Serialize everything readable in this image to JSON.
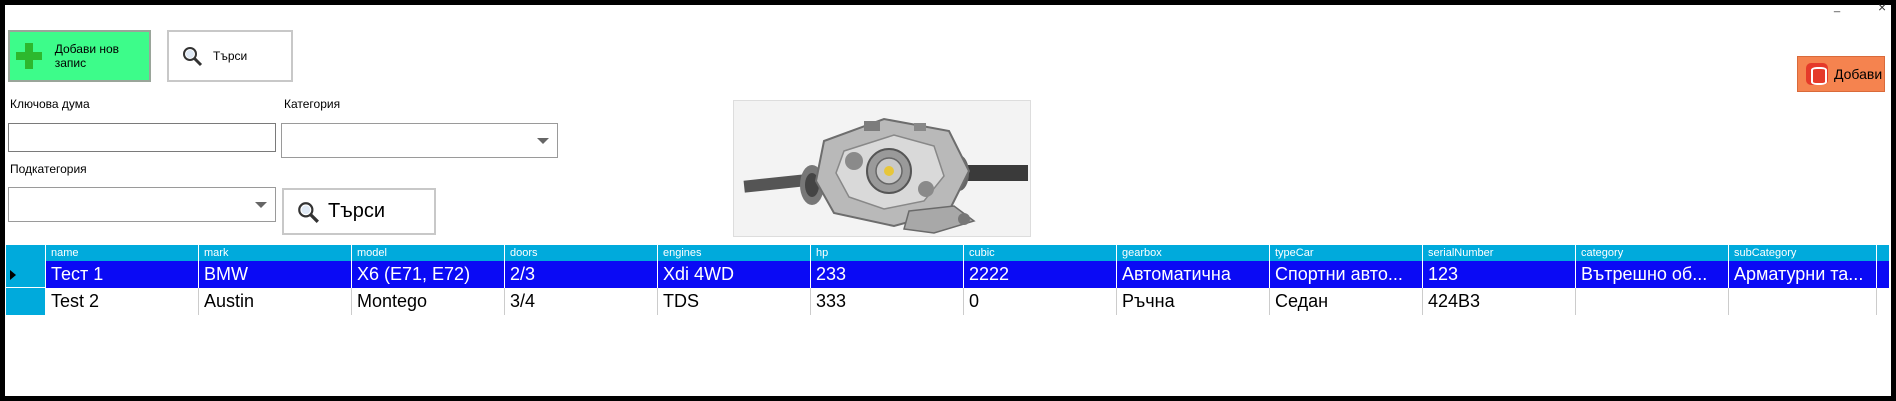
{
  "toolbar": {
    "add_record_label": "Добави нов запис",
    "search_label": "Търси",
    "add_db_label": "Добави"
  },
  "filters": {
    "keyword_label": "Ключова дума",
    "keyword_value": "",
    "category_label": "Категория",
    "category_value": "",
    "subcategory_label": "Подкатегория",
    "subcategory_value": "",
    "search_button_label": "Търси"
  },
  "window": {
    "minimize_glyph": "_",
    "close_glyph": "×"
  },
  "grid": {
    "columns": [
      "name",
      "mark",
      "model",
      "doors",
      "engines",
      "hp",
      "cubic",
      "gearbox",
      "typeCar",
      "serialNumber",
      "category",
      "subCategory"
    ],
    "rows": [
      [
        "Тест 1",
        "BMW",
        "X6 (E71, E72)",
        "2/3",
        "Xdi 4WD",
        "233",
        "2222",
        "Автоматична",
        "Спортни авто...",
        "123",
        "Вътрешно об...",
        "Арматурни та..."
      ],
      [
        "Test 2",
        "Austin",
        "Montego",
        "3/4",
        "TDS",
        "333",
        "0",
        "Ръчна",
        "Седан",
        "424В3",
        "",
        ""
      ]
    ],
    "selected_row": 0
  },
  "colors": {
    "grid_header": "#00aadc",
    "selected_row": "#0a0af5",
    "add_record_bg": "#3dfc8a",
    "add_db_bg": "#f5834f"
  },
  "icons": {
    "add_record": "plus-icon",
    "search": "magnifier-icon",
    "add_db": "database-icon",
    "row_pointer": "row-pointer-icon"
  }
}
